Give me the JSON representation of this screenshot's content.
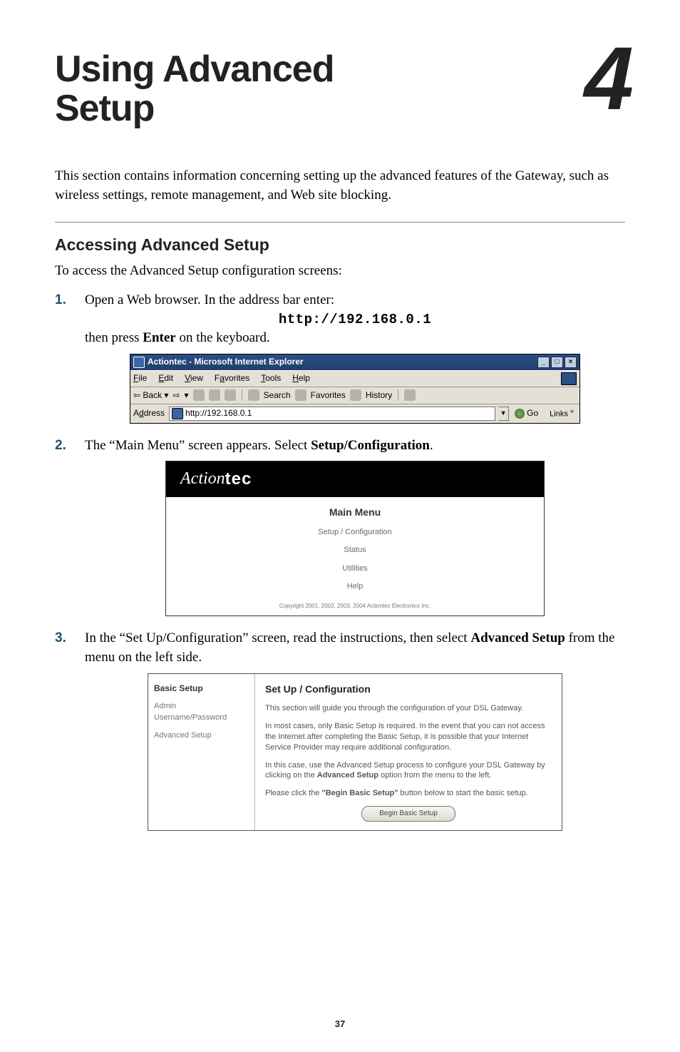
{
  "chapter": {
    "title_line1": "Using Advanced",
    "title_line2": "Setup",
    "number": "4"
  },
  "intro": "This section contains information concerning setting up the advanced features of the Gateway, such as wireless settings, remote management, and Web site blocking.",
  "section_heading": "Accessing Advanced Setup",
  "section_lead": "To access the Advanced Setup configuration screens:",
  "steps": {
    "s1a": "Open a Web browser. In the address bar enter:",
    "s1_url": "http://192.168.0.1",
    "s1b_pre": "then press ",
    "s1b_bold": "Enter",
    "s1b_post": " on the keyboard.",
    "s2_pre": "The “Main Menu” screen appears. Select ",
    "s2_bold": "Setup/Configuration",
    "s2_post": ".",
    "s3_pre": "In the “Set Up/Configuration” screen, read the instructions, then select ",
    "s3_bold": "Advanced Setup",
    "s3_post": " from the menu on the left side."
  },
  "ie": {
    "title": "Actiontec - Microsoft Internet Explorer",
    "menu": {
      "file": "File",
      "edit": "Edit",
      "view": "View",
      "favorites": "Favorites",
      "tools": "Tools",
      "help": "Help"
    },
    "tool": {
      "back": "Back",
      "search": "Search",
      "fav": "Favorites",
      "history": "History"
    },
    "addr_label": "Address",
    "addr_value": "http://192.168.0.1",
    "go": "Go",
    "links": "Links",
    "btn_min": "_",
    "btn_max": "□",
    "btn_close": "×"
  },
  "actiontec": {
    "logo_italic": "Action",
    "logo_bold": "tec",
    "main_menu": "Main Menu",
    "items": [
      "Setup / Configuration",
      "Status",
      "Utilities",
      "Help"
    ],
    "copyright": "Copyright 2001, 2002, 2003, 2004 Actiontec Electronics Inc."
  },
  "cfg": {
    "left_title": "Basic Setup",
    "left_items": [
      "Admin Username/Password",
      "Advanced Setup"
    ],
    "right_title": "Set Up / Configuration",
    "p1": "This section will guide you through the configuration of your DSL Gateway.",
    "p2": "In most cases, only Basic Setup is required. In the event that you can not access the Internet after completing the Basic Setup, it is possible that your Internet Service Provider may require additional configuration.",
    "p3_a": "In this case, use the Advanced Setup process to configure your DSL Gateway by clicking on the ",
    "p3_bold": "Advanced Setup",
    "p3_b": " option from the menu to the left.",
    "p4_a": "Please click the ",
    "p4_bold": "\"Begin Basic Setup\"",
    "p4_b": " button below to start the basic setup.",
    "button": "Begin Basic Setup"
  },
  "page_number": "37"
}
